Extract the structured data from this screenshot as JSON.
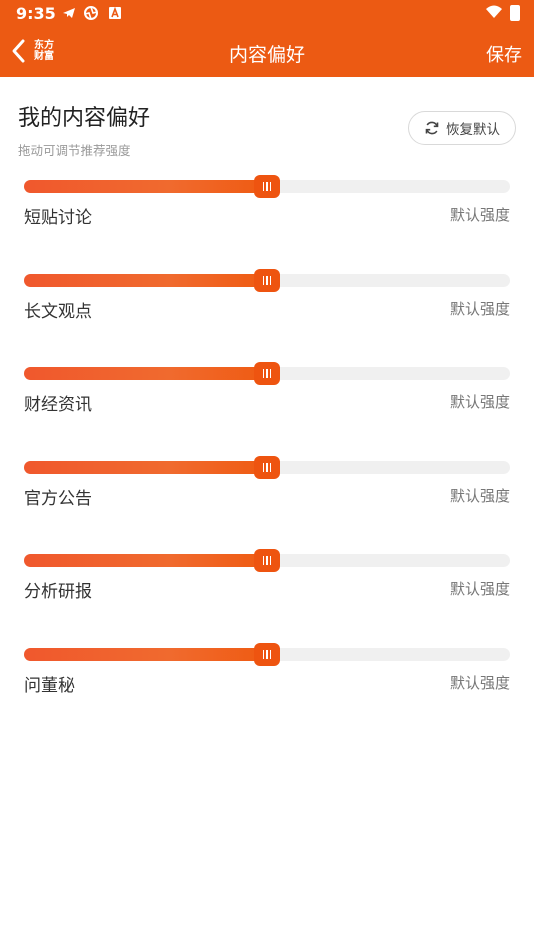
{
  "status_bar": {
    "time": "9:35",
    "icons": [
      "telegram-icon",
      "aperture-icon",
      "a-badge-icon"
    ],
    "right_icons": [
      "wifi-icon",
      "battery-icon"
    ]
  },
  "navbar": {
    "brand_line1": "东方",
    "brand_line2": "财富",
    "title": "内容偏好",
    "save_label": "保存",
    "background": "#ec5a13"
  },
  "header": {
    "title": "我的内容偏好",
    "subtitle": "拖动可调节推荐强度",
    "reset_label": "恢复默认"
  },
  "preferences": [
    {
      "label": "短贴讨论",
      "level_label": "默认强度",
      "value": 0.5
    },
    {
      "label": "长文观点",
      "level_label": "默认强度",
      "value": 0.5
    },
    {
      "label": "财经资讯",
      "level_label": "默认强度",
      "value": 0.5
    },
    {
      "label": "官方公告",
      "level_label": "默认强度",
      "value": 0.5
    },
    {
      "label": "分析研报",
      "level_label": "默认强度",
      "value": 0.5
    },
    {
      "label": "问董秘",
      "level_label": "默认强度",
      "value": 0.5
    }
  ],
  "colors": {
    "accent": "#ee5410",
    "track": "#f0f0f0"
  }
}
